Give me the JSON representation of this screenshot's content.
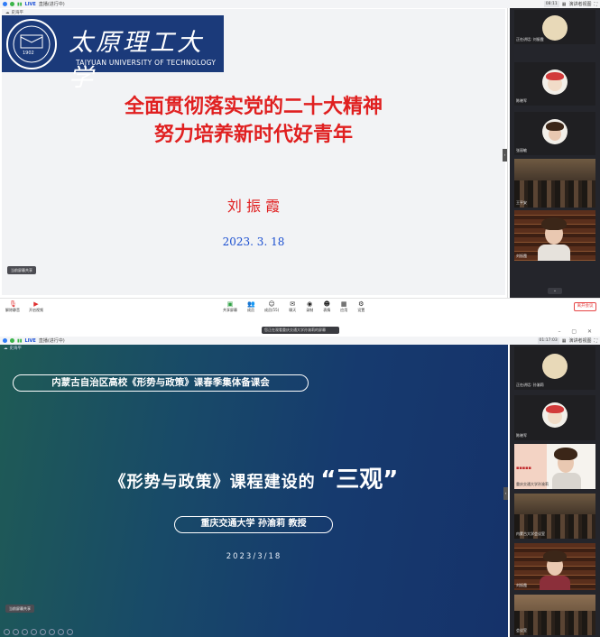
{
  "session1": {
    "topbar": {
      "live": "LIVE",
      "title": "直播(进行中)",
      "time": "08:11",
      "view_btn": "演讲者视图"
    },
    "sharer_tag": "史海平",
    "slide": {
      "logo_cn": "太原理工大学",
      "logo_en": "TAIYUAN UNIVERSITY OF TECHNOLOGY",
      "seal_year": "1902",
      "title_line1": "全面贯彻落实党的二十大精神",
      "title_line2": "努力培养新时代好青年",
      "author": "刘 振 霞",
      "date": "2023. 3. 18"
    },
    "status_pill": "当前屏幕共享",
    "participants": [
      {
        "name": "正在讲话: 刘振霞"
      },
      {
        "name": "陈晓军"
      },
      {
        "name": "张丽敏"
      },
      {
        "name": "王平安"
      },
      {
        "name": "内蒙古大学会议室"
      },
      {
        "name": "刘振霞"
      }
    ],
    "toolbar": {
      "left": [
        {
          "icon": "mic-icon",
          "label": "解除静音"
        },
        {
          "icon": "video-icon",
          "label": "开启视频"
        }
      ],
      "mid": [
        {
          "icon": "share-screen-icon",
          "label": "共享屏幕"
        },
        {
          "icon": "participants-icon",
          "label": "成员"
        },
        {
          "icon": "members-icon",
          "label": "成员(55)"
        },
        {
          "icon": "chat-icon",
          "label": "聊天"
        },
        {
          "icon": "record-icon",
          "label": "录制"
        },
        {
          "icon": "reaction-icon",
          "label": "表情"
        },
        {
          "icon": "apps-icon",
          "label": "应用"
        },
        {
          "icon": "settings-icon",
          "label": "设置"
        }
      ],
      "leave": "离开会议"
    }
  },
  "session2": {
    "share_bar": "您正在观看重庆交通大学孙渝莉的屏幕",
    "topbar": {
      "live": "LIVE",
      "title": "直播(进行中)",
      "time": "01:17:03",
      "view_btn": "演讲者视图"
    },
    "sharer_tag": "史海平",
    "slide": {
      "banner": "内蒙古自治区高校《形势与政策》课春季集体备课会",
      "title_main": "《形势与政策》课程建设的",
      "title_quote": "“三观”",
      "speaker": "重庆交通大学  孙渝莉 教授",
      "date": "2023/3/18"
    },
    "status_pill": "当前屏幕共享",
    "participants": [
      {
        "name": "正在讲话: 孙渝莉"
      },
      {
        "name": "陈晓军"
      },
      {
        "name": "重庆交通大学孙渝莉"
      },
      {
        "name": "内蒙古大学会议室"
      },
      {
        "name": "刘振霞"
      },
      {
        "name": "会议室"
      }
    ]
  },
  "colors": {
    "red_title": "#e02020",
    "navy_logo": "#1b3a7a",
    "slide2_bg": "#163a6e",
    "leave_red": "#e64545"
  }
}
